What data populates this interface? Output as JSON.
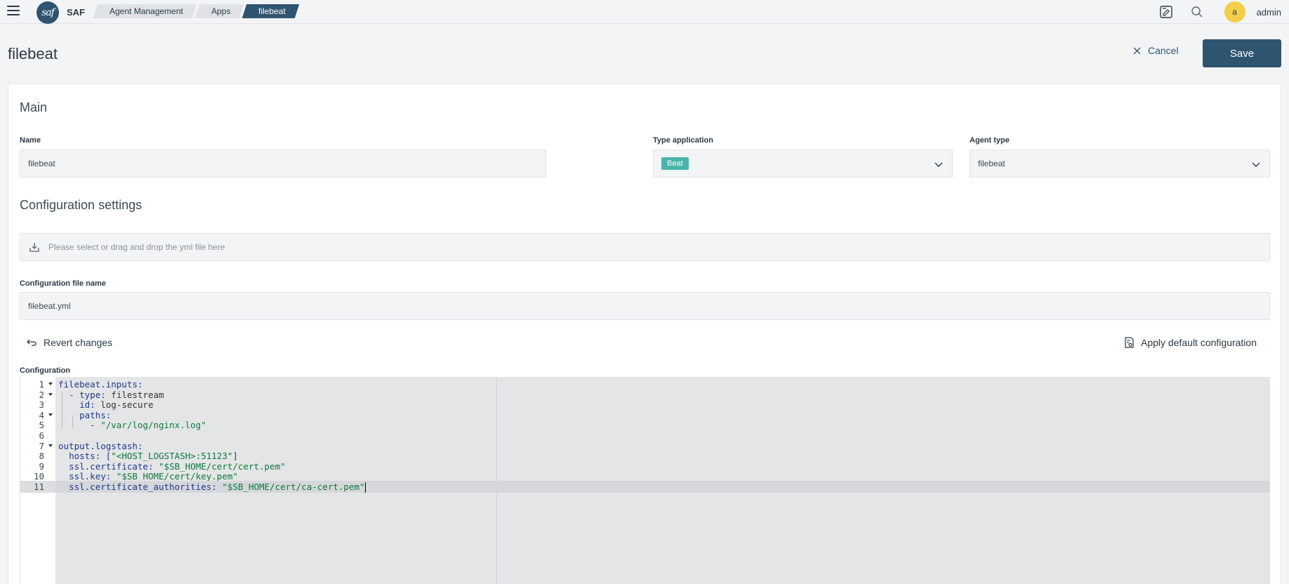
{
  "header": {
    "app_name": "SAF",
    "logo_text": "saf",
    "breadcrumbs": [
      "Agent Management",
      "Apps",
      "filebeat"
    ],
    "avatar_letter": "a",
    "username": "admin"
  },
  "page": {
    "title": "filebeat",
    "cancel_label": "Cancel",
    "save_label": "Save"
  },
  "main_section": {
    "title": "Main",
    "name_label": "Name",
    "name_value": "filebeat",
    "type_label": "Type application",
    "type_value": "Beat",
    "agent_type_label": "Agent type",
    "agent_type_value": "filebeat"
  },
  "config_section": {
    "title": "Configuration settings",
    "dropzone_placeholder": "Please select or drag and drop the yml file here",
    "file_name_label": "Configuration file name",
    "file_name_value": "filebeat.yml",
    "revert_label": "Revert changes",
    "apply_default_label": "Apply default configuration",
    "editor_label": "Configuration"
  },
  "editor": {
    "active_line": 11,
    "lines": [
      {
        "n": "1",
        "fold": true,
        "text": "filebeat.inputs:"
      },
      {
        "n": "2",
        "fold": true,
        "text": "  - type: filestream"
      },
      {
        "n": "3",
        "fold": false,
        "text": "    id: log-secure"
      },
      {
        "n": "4",
        "fold": true,
        "text": "    paths:"
      },
      {
        "n": "5",
        "fold": false,
        "text": "      - \"/var/log/nginx.log\""
      },
      {
        "n": "6",
        "fold": false,
        "text": ""
      },
      {
        "n": "7",
        "fold": true,
        "text": "output.logstash:"
      },
      {
        "n": "8",
        "fold": false,
        "text": "  hosts: [\"<HOST_LOGSTASH>:51123\"]"
      },
      {
        "n": "9",
        "fold": false,
        "text": "  ssl.certificate: \"$SB_HOME/cert/cert.pem\""
      },
      {
        "n": "10",
        "fold": false,
        "text": "  ssl.key: \"$SB_HOME/cert/key.pem\""
      },
      {
        "n": "11",
        "fold": false,
        "text": "  ssl.certificate_authorities: \"$SB_HOME/cert/ca-cert.pem\""
      }
    ]
  }
}
